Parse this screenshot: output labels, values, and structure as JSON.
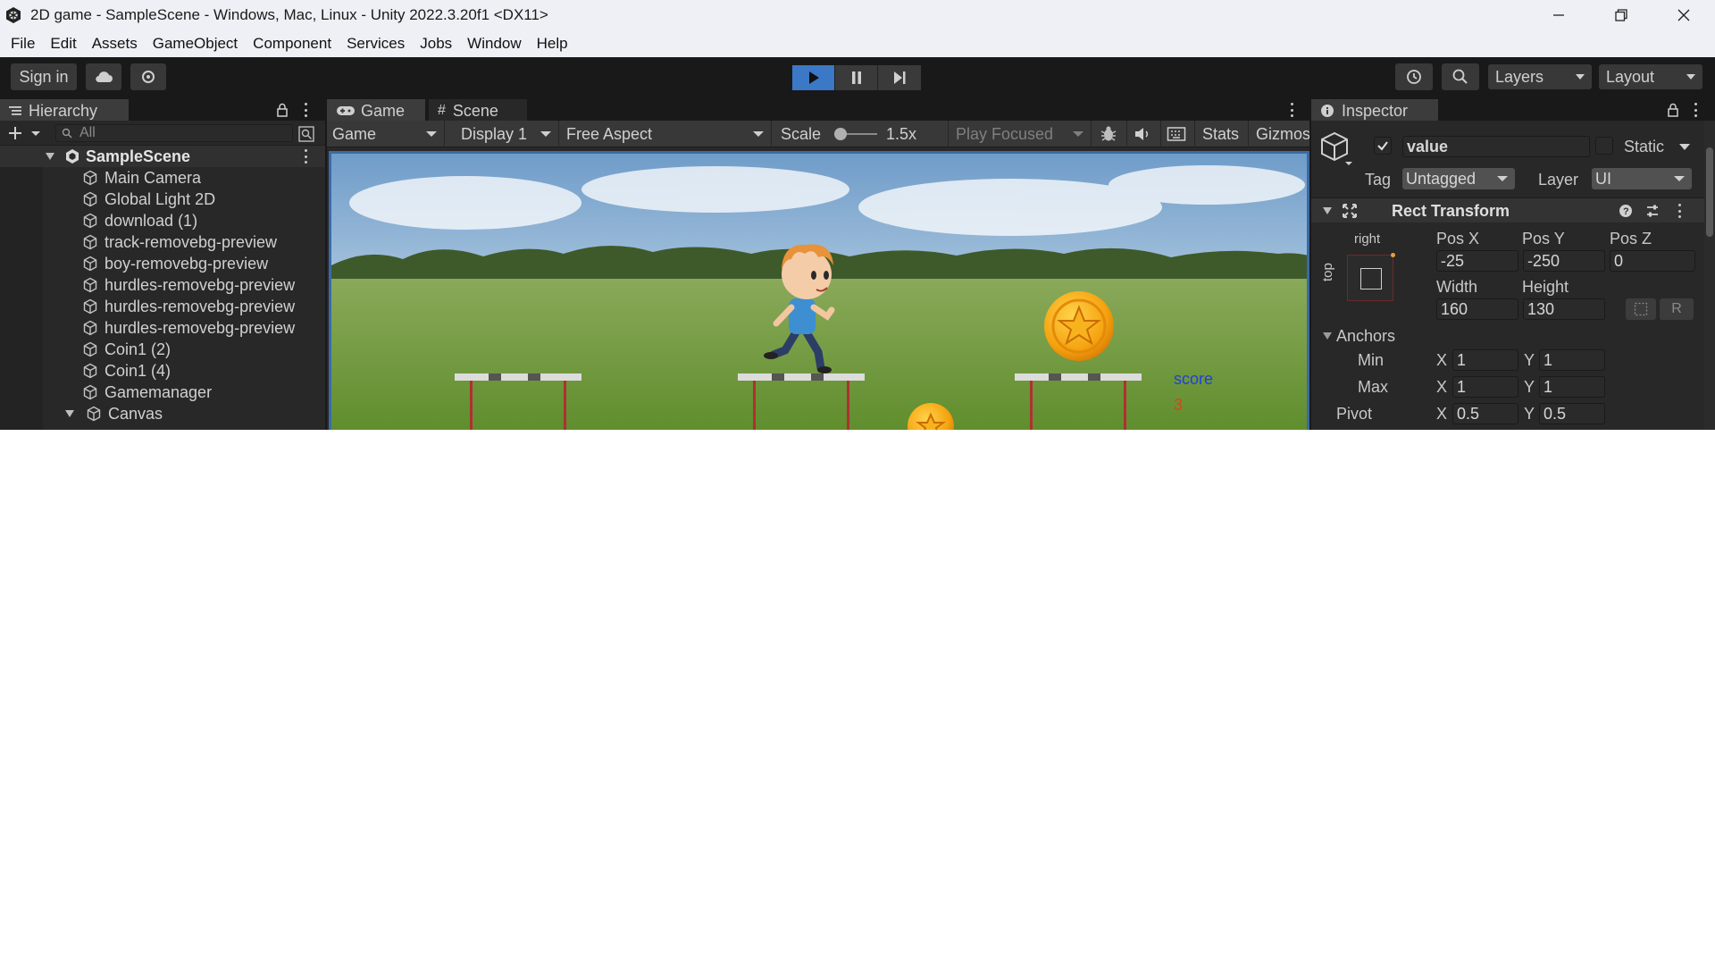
{
  "window": {
    "title": "2D game - SampleScene - Windows, Mac, Linux - Unity 2022.3.20f1 <DX11>"
  },
  "menu": [
    "File",
    "Edit",
    "Assets",
    "GameObject",
    "Component",
    "Services",
    "Jobs",
    "Window",
    "Help"
  ],
  "toolbar": {
    "sign_in": "Sign in",
    "layers": "Layers",
    "layout": "Layout"
  },
  "hierarchy": {
    "tab": "Hierarchy",
    "search_placeholder": "All",
    "scene": "SampleScene",
    "items": [
      "Main Camera",
      "Global Light 2D",
      "download (1)",
      "track-removebg-preview",
      "boy-removebg-preview",
      "hurdles-removebg-preview",
      "hurdles-removebg-preview",
      "hurdles-removebg-preview",
      "Coin1 (2)",
      "Coin1 (4)",
      "Gamemanager",
      "Canvas"
    ]
  },
  "game_view": {
    "tab_game": "Game",
    "tab_scene": "Scene",
    "mode": "Game",
    "display": "Display 1",
    "aspect": "Free Aspect",
    "scale_label": "Scale",
    "scale_value": "1.5x",
    "play_mode": "Play Focused",
    "stats": "Stats",
    "gizmos": "Gizmos",
    "score_label": "score",
    "score_value": "3"
  },
  "inspector": {
    "tab": "Inspector",
    "object_name": "value",
    "static_label": "Static",
    "tag_label": "Tag",
    "tag_value": "Untagged",
    "layer_label": "Layer",
    "layer_value": "UI",
    "component_title": "Rect Transform",
    "anchor_preset_h": "right",
    "anchor_preset_v": "top",
    "pos_x_label": "Pos X",
    "pos_y_label": "Pos Y",
    "pos_z_label": "Pos Z",
    "pos_x": "-25",
    "pos_y": "-250",
    "pos_z": "0",
    "width_label": "Width",
    "height_label": "Height",
    "width": "160",
    "height": "130",
    "r_button": "R",
    "anchors_label": "Anchors",
    "min_label": "Min",
    "max_label": "Max",
    "x_label": "X",
    "y_label": "Y",
    "min_x": "1",
    "min_y": "1",
    "max_x": "1",
    "max_y": "1",
    "pivot_label": "Pivot",
    "pivot_x": "0.5",
    "pivot_y": "0.5"
  },
  "colors": {
    "play_active": "#3b78c6",
    "score_label": "#1f3fe0",
    "score_value": "#e0401a"
  }
}
